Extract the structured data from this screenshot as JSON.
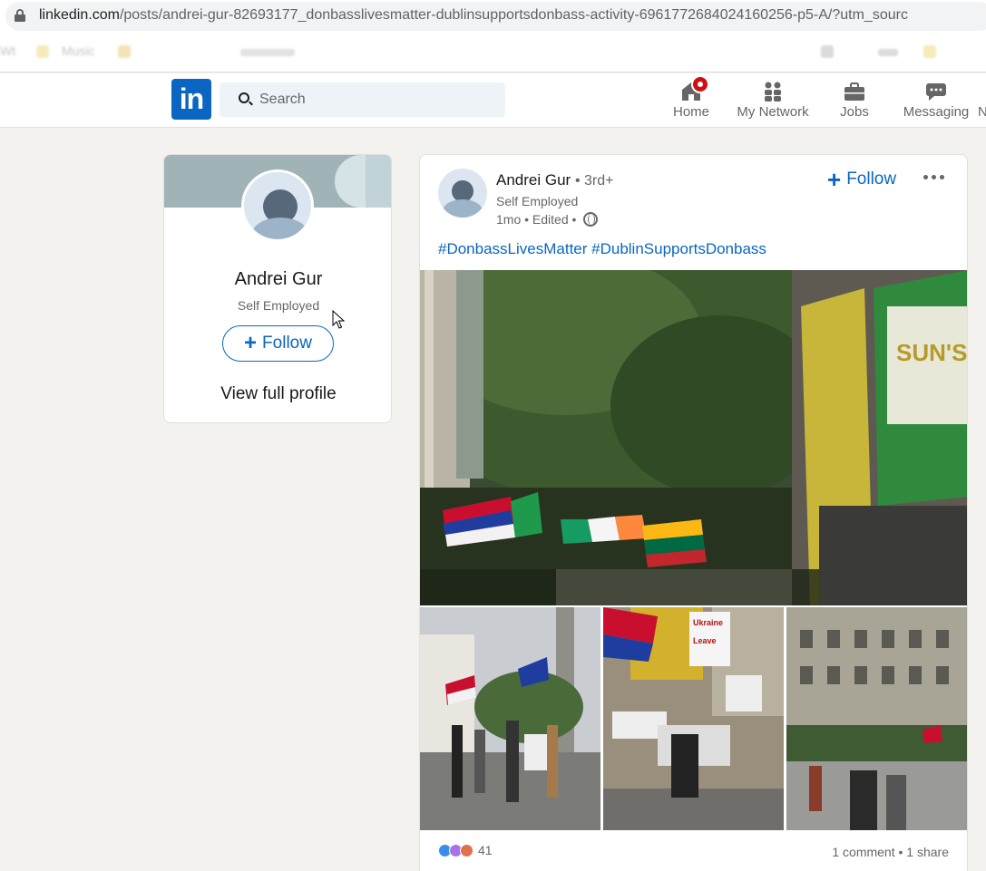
{
  "browser": {
    "url_host": "linkedin.com",
    "url_path": "/posts/andrei-gur-82693177_donbasslivesmatter-dublinsupportsdonbass-activity-6961772684024160256-p5-A/?utm_sourc",
    "bookmarks": [
      "Wt",
      "Music"
    ]
  },
  "nav": {
    "search_placeholder": "Search",
    "items": [
      {
        "label": "Home",
        "icon": "home-icon"
      },
      {
        "label": "My Network",
        "icon": "network-icon"
      },
      {
        "label": "Jobs",
        "icon": "briefcase-icon"
      },
      {
        "label": "Messaging",
        "icon": "messaging-icon"
      },
      {
        "label": "N",
        "icon": "notifications-icon"
      }
    ],
    "accent": "#0a66c2",
    "badge_color": "#cc1016"
  },
  "profile_card": {
    "name": "Andrei Gur",
    "headline": "Self Employed",
    "follow_label": "Follow",
    "view_profile_label": "View full profile"
  },
  "post": {
    "author": "Andrei Gur",
    "degree": "• 3rd+",
    "headline": "Self Employed",
    "time": "1mo • Edited •",
    "follow_label": "Follow",
    "hashtags": "#DonbassLivesMatter #DublinSupportsDonbass",
    "reaction_count": "41",
    "comments": "1 comment",
    "shares": "1 share",
    "reactions": [
      "like-icon",
      "support-icon",
      "love-icon"
    ]
  }
}
